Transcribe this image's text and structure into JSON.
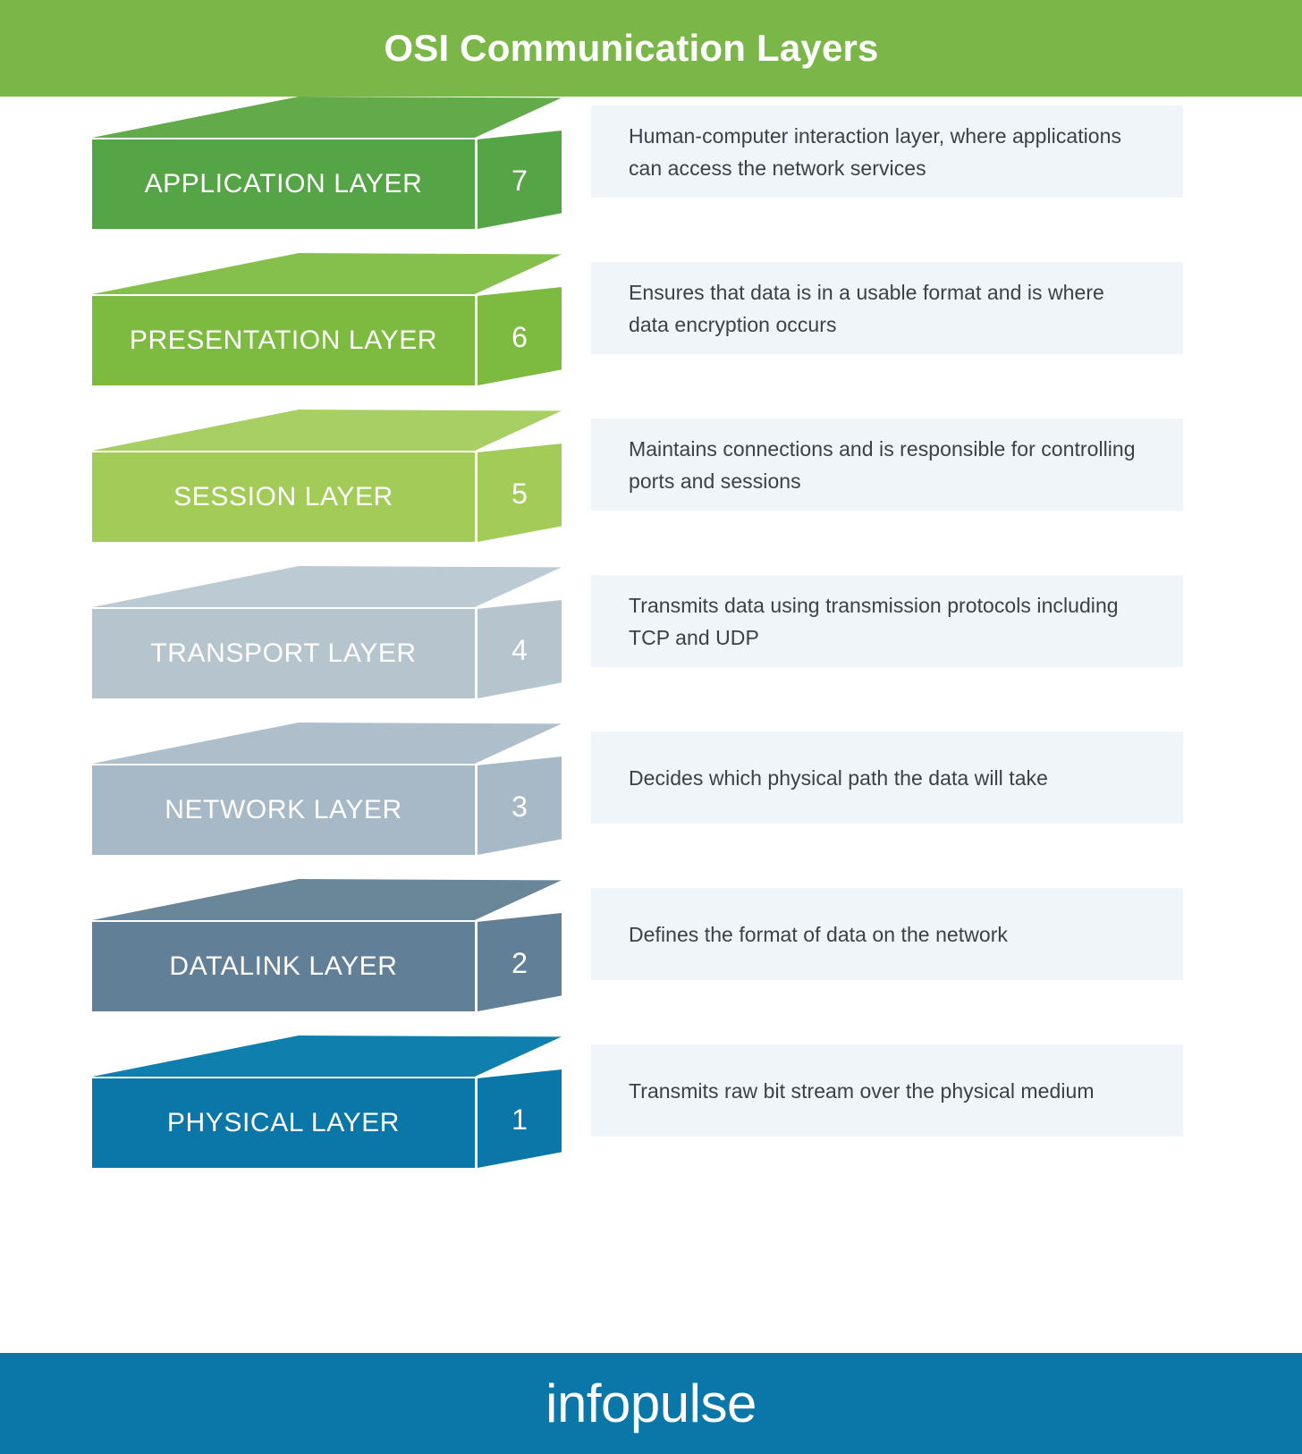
{
  "header": {
    "title": "OSI Communication Layers",
    "background_color": "#7ab648",
    "text_color": "#ffffff"
  },
  "footer": {
    "logo": "infopulse",
    "background_color": "#0a77a8",
    "text_color": "#ffffff"
  },
  "layers": [
    {
      "name": "APPLICATION LAYER",
      "number": "7",
      "description": "Human-computer interaction layer, where applications can access the network services",
      "front_color": "#55a546",
      "top_color": "#63ab4a",
      "side_color": "#55a546"
    },
    {
      "name": "PRESENTATION LAYER",
      "number": "6",
      "description": "Ensures that data is in a usable format and is where data encryption occurs",
      "front_color": "#7cbb3f",
      "top_color": "#86c04c",
      "side_color": "#7cbb3f"
    },
    {
      "name": "SESSION LAYER",
      "number": "5",
      "description": "Maintains connections and is responsible for controlling ports and sessions",
      "front_color": "#a2cb58",
      "top_color": "#a8cf63",
      "side_color": "#a2cb58"
    },
    {
      "name": "TRANSPORT LAYER",
      "number": "4",
      "description": "Transmits data using transmission protocols including TCP and UDP",
      "front_color": "#b6c4ce",
      "top_color": "#bccad3",
      "side_color": "#b6c4ce"
    },
    {
      "name": "NETWORK LAYER",
      "number": "3",
      "description": "Decides which physical path the data will take",
      "front_color": "#a7b8c6",
      "top_color": "#aebecb",
      "side_color": "#a7b8c6"
    },
    {
      "name": "DATALINK LAYER",
      "number": "2",
      "description": "Defines the format of data on the network",
      "front_color": "#617f97",
      "top_color": "#6a8699",
      "side_color": "#617f97"
    },
    {
      "name": "PHYSICAL LAYER",
      "number": "1",
      "description": "Transmits raw bit stream over the physical medium",
      "front_color": "#0a77a8",
      "top_color": "#0f7fae",
      "side_color": "#0a77a8"
    }
  ],
  "palette": {
    "page_background": "#ffffff",
    "description_background": "#f0f5f9",
    "description_text": "#3b4148",
    "edge_highlight": "#ffffff"
  }
}
